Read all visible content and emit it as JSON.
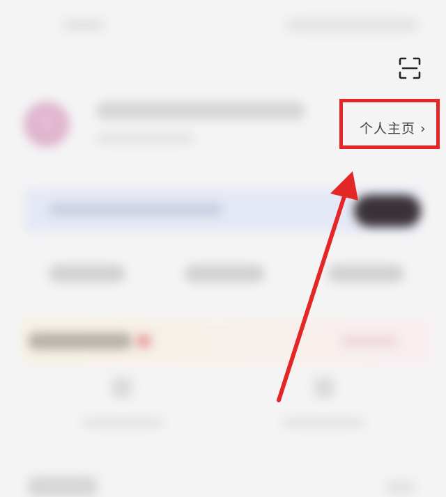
{
  "header": {
    "scan_icon": "scan-icon"
  },
  "profile": {
    "homepage_link_label": "个人主页 ›"
  },
  "annotation": {
    "highlight_color": "#e32626",
    "arrow_color": "#e32626"
  }
}
